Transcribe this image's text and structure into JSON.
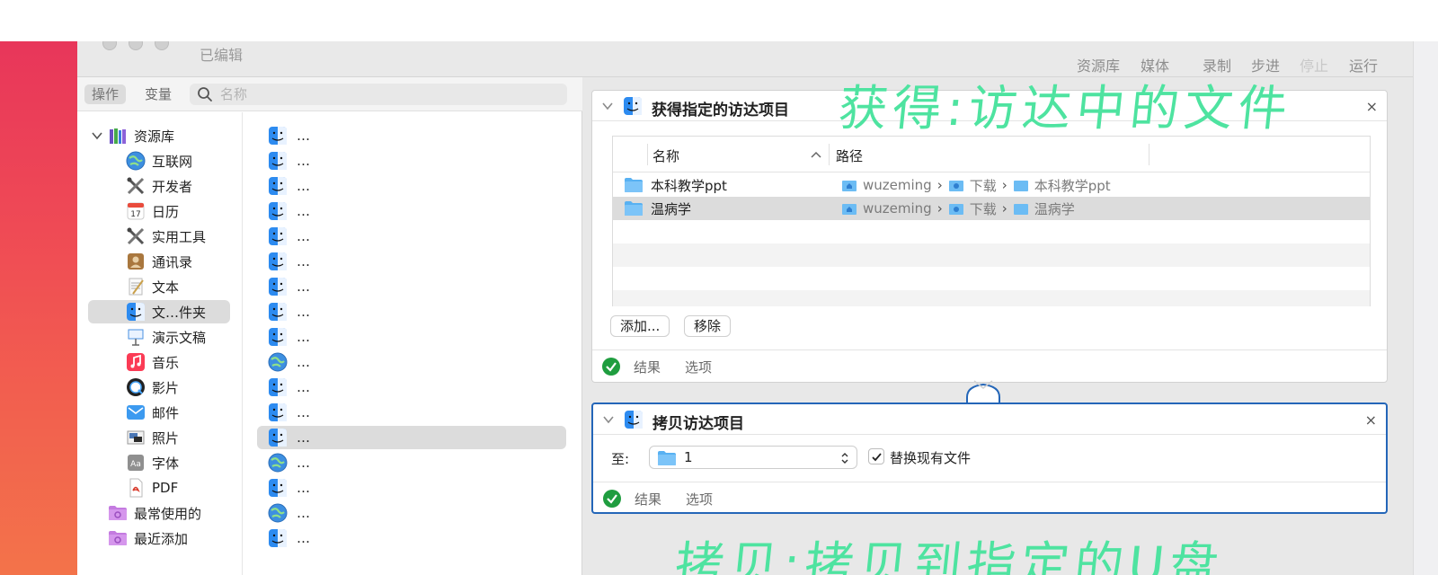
{
  "window": {
    "subtitle": "已编辑",
    "toolbar": [
      "资源库",
      "媒体",
      "录制",
      "步进",
      "停止",
      "运行"
    ]
  },
  "library": {
    "tabs": [
      "操作",
      "变量"
    ],
    "search_placeholder": "名称",
    "root_label": "资源库",
    "categories": [
      {
        "label": "互联网",
        "icon": "globe-icon"
      },
      {
        "label": "开发者",
        "icon": "tools-icon"
      },
      {
        "label": "日历",
        "icon": "calendar-icon",
        "icon_text": "17"
      },
      {
        "label": "实用工具",
        "icon": "tools-icon"
      },
      {
        "label": "通讯录",
        "icon": "contacts-icon"
      },
      {
        "label": "文本",
        "icon": "text-icon"
      },
      {
        "label": "文…件夹",
        "icon": "finder-icon"
      },
      {
        "label": "演示文稿",
        "icon": "keynote-icon"
      },
      {
        "label": "音乐",
        "icon": "music-icon"
      },
      {
        "label": "影片",
        "icon": "movie-icon"
      },
      {
        "label": "邮件",
        "icon": "mail-icon"
      },
      {
        "label": "照片",
        "icon": "photos-icon"
      },
      {
        "label": "字体",
        "icon": "font-icon",
        "icon_text": "Aa"
      },
      {
        "label": "PDF",
        "icon": "pdf-icon"
      }
    ],
    "smart_groups": [
      "最常使用的",
      "最近添加"
    ],
    "actions": [
      {
        "label": "…",
        "icon": "finder-icon"
      },
      {
        "label": "…",
        "icon": "finder-icon"
      },
      {
        "label": "…",
        "icon": "finder-icon"
      },
      {
        "label": "…",
        "icon": "finder-icon"
      },
      {
        "label": "…",
        "icon": "finder-icon"
      },
      {
        "label": "…",
        "icon": "finder-icon"
      },
      {
        "label": "…",
        "icon": "finder-icon"
      },
      {
        "label": "…",
        "icon": "finder-icon"
      },
      {
        "label": "…",
        "icon": "finder-icon"
      },
      {
        "label": "…",
        "icon": "globe-icon"
      },
      {
        "label": "…",
        "icon": "finder-icon"
      },
      {
        "label": "…",
        "icon": "finder-icon"
      },
      {
        "label": "…",
        "icon": "finder-icon"
      },
      {
        "label": "…",
        "icon": "globe-icon"
      },
      {
        "label": "…",
        "icon": "finder-icon"
      },
      {
        "label": "…",
        "icon": "globe-icon"
      },
      {
        "label": "…",
        "icon": "finder-icon"
      }
    ]
  },
  "action1": {
    "title": "获得指定的访达项目",
    "close": "×",
    "columns": [
      "名称",
      "路径"
    ],
    "rows": [
      {
        "name": "本科教学ppt",
        "path": [
          "wuzeming",
          "下载",
          "本科教学ppt"
        ]
      },
      {
        "name": "温病学",
        "path": [
          "wuzeming",
          "下载",
          "温病学"
        ]
      }
    ],
    "add_label": "添加...",
    "remove_label": "移除",
    "results_label": "结果",
    "options_label": "选项"
  },
  "action2": {
    "title": "拷贝访达项目",
    "close": "×",
    "to_label": "至:",
    "to_value": "1",
    "replace_label": "替换现有文件",
    "results_label": "结果",
    "options_label": "选项"
  },
  "annotations": {
    "top": "获得:访达中的文件",
    "bottom": "拷贝:拷贝到指定的U盘"
  },
  "colors": {
    "selection_blue": "#2466b8",
    "annotation_green": "#4ee3a0",
    "ok_green": "#1f9d3f"
  }
}
